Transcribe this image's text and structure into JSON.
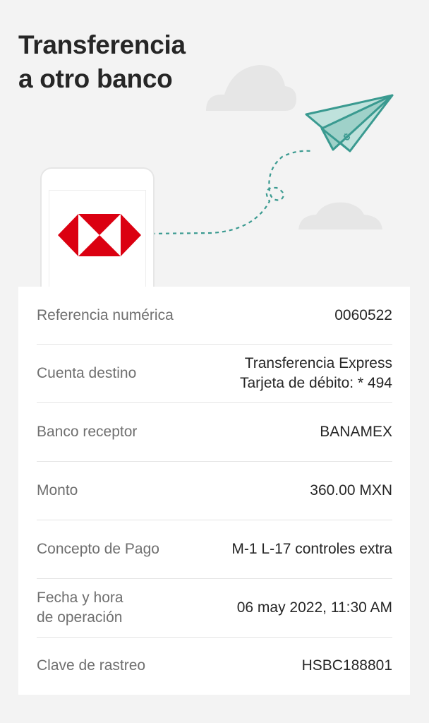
{
  "header": {
    "title": "Transferencia\na otro banco"
  },
  "illustration": {
    "logo_colors": {
      "red": "#db0011",
      "white": "#ffffff"
    },
    "plane_color": "#3a9a90",
    "cloud_color": "#e6e6e6"
  },
  "details": {
    "rows": [
      {
        "label": "Referencia numérica",
        "value": "0060522"
      },
      {
        "label": "Cuenta destino",
        "value": "Transferencia Express\nTarjeta de débito: * 494"
      },
      {
        "label": "Banco receptor",
        "value": "BANAMEX"
      },
      {
        "label": "Monto",
        "value": "360.00 MXN"
      },
      {
        "label": "Concepto de Pago",
        "value": "M-1 L-17 controles extra"
      },
      {
        "label": "Fecha y hora\nde operación",
        "value": "06 may 2022, 11:30 AM"
      },
      {
        "label": "Clave de rastreo",
        "value": "HSBC188801"
      }
    ]
  }
}
